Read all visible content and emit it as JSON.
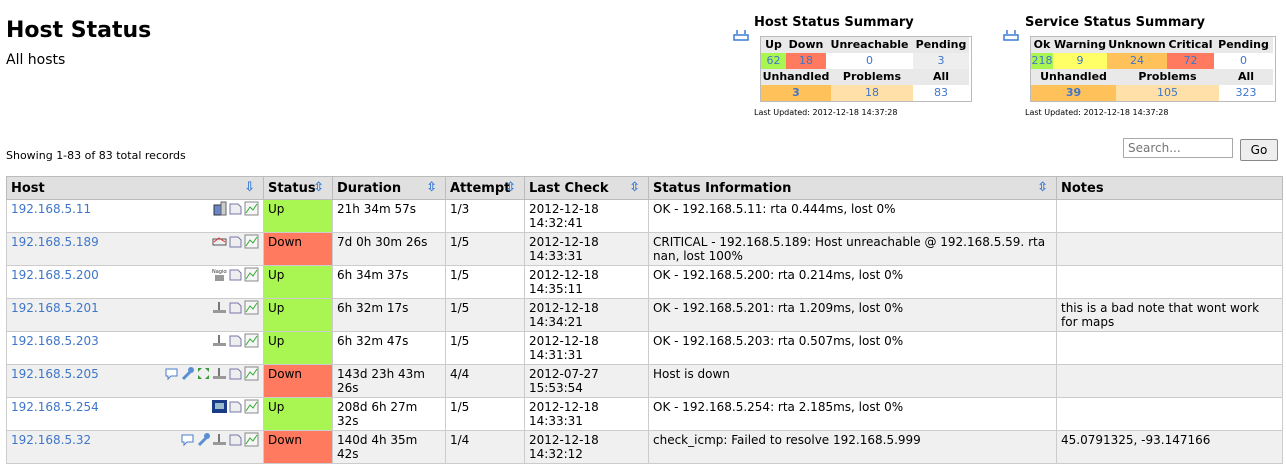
{
  "header": {
    "title": "Host Status",
    "subtitle": "All hosts"
  },
  "host_summary": {
    "title": "Host Status Summary",
    "headers": [
      "Up",
      "Down",
      "Unreachable",
      "Pending"
    ],
    "values": [
      "62",
      "18",
      "0",
      "3"
    ],
    "sub_headers": [
      "Unhandled",
      "Problems",
      "All"
    ],
    "sub_values": [
      "3",
      "18",
      "83"
    ],
    "updated": "Last Updated: 2012-12-18 14:37:28"
  },
  "service_summary": {
    "title": "Service Status Summary",
    "headers": [
      "Ok",
      "Warning",
      "Unknown",
      "Critical",
      "Pending"
    ],
    "values": [
      "218",
      "9",
      "24",
      "72",
      "0"
    ],
    "sub_headers": [
      "Unhandled",
      "Problems",
      "All"
    ],
    "sub_values": [
      "39",
      "105",
      "323"
    ],
    "updated": "Last Updated: 2012-12-18 14:37:28"
  },
  "records": {
    "showing": "Showing 1-83 of 83 total records"
  },
  "search": {
    "placeholder": "Search...",
    "go_label": "Go"
  },
  "columns": [
    "Host",
    "Status",
    "Duration",
    "Attempt",
    "Last Check",
    "Status Information",
    "Notes"
  ],
  "colors": {
    "up": "#a9f552",
    "down": "#ff7a5e",
    "link": "#3f76c9"
  },
  "rows": [
    {
      "host": "192.168.5.11",
      "icons": [
        "server-icon",
        "notes-icon",
        "graph-icon"
      ],
      "status": "Up",
      "duration": "21h 34m 57s",
      "attempt": "1/3",
      "last_check": "2012-12-18 14:32:41",
      "info": "OK - 192.168.5.11: rta 0.444ms, lost 0%",
      "notes": ""
    },
    {
      "host": "192.168.5.189",
      "icons": [
        "device-icon",
        "notes-icon",
        "graph-icon"
      ],
      "status": "Down",
      "duration": "7d 0h 30m 26s",
      "attempt": "1/5",
      "last_check": "2012-12-18 14:33:31",
      "info": "CRITICAL - 192.168.5.189: Host unreachable @ 192.168.5.59. rta nan, lost 100%",
      "notes": ""
    },
    {
      "host": "192.168.5.200",
      "icons": [
        "nagios-icon",
        "notes-icon",
        "graph-icon"
      ],
      "status": "Up",
      "duration": "6h 34m 37s",
      "attempt": "1/5",
      "last_check": "2012-12-18 14:35:11",
      "info": "OK - 192.168.5.200: rta 0.214ms, lost 0%",
      "notes": ""
    },
    {
      "host": "192.168.5.201",
      "icons": [
        "network-icon",
        "notes-icon",
        "graph-icon"
      ],
      "status": "Up",
      "duration": "6h 32m 17s",
      "attempt": "1/5",
      "last_check": "2012-12-18 14:34:21",
      "info": "OK - 192.168.5.201: rta 1.209ms, lost 0%",
      "notes": "this is a bad note that wont work for maps"
    },
    {
      "host": "192.168.5.203",
      "icons": [
        "network-icon",
        "notes-icon",
        "graph-icon"
      ],
      "status": "Up",
      "duration": "6h 32m 47s",
      "attempt": "1/5",
      "last_check": "2012-12-18 14:31:31",
      "info": "OK - 192.168.5.203: rta 0.507ms, lost 0%",
      "notes": ""
    },
    {
      "host": "192.168.5.205",
      "icons": [
        "comment-icon",
        "wrench-icon",
        "expand-icon",
        "network-icon",
        "notes-icon",
        "graph-icon"
      ],
      "status": "Down",
      "duration": "143d 23h 43m 26s",
      "attempt": "4/4",
      "last_check": "2012-07-27 15:53:54",
      "info": "Host is down",
      "notes": ""
    },
    {
      "host": "192.168.5.254",
      "icons": [
        "monitor-icon",
        "notes-icon",
        "graph-icon"
      ],
      "status": "Up",
      "duration": "208d 6h 27m 32s",
      "attempt": "1/5",
      "last_check": "2012-12-18 14:33:31",
      "info": "OK - 192.168.5.254: rta 2.185ms, lost 0%",
      "notes": ""
    },
    {
      "host": "192.168.5.32",
      "icons": [
        "comment-icon",
        "wrench-icon",
        "network-icon",
        "notes-icon",
        "graph-icon"
      ],
      "status": "Down",
      "duration": "140d 4h 35m 42s",
      "attempt": "1/4",
      "last_check": "2012-12-18 14:32:12",
      "info": "check_icmp: Failed to resolve 192.168.5.999",
      "notes": "45.0791325, -93.147166"
    }
  ]
}
